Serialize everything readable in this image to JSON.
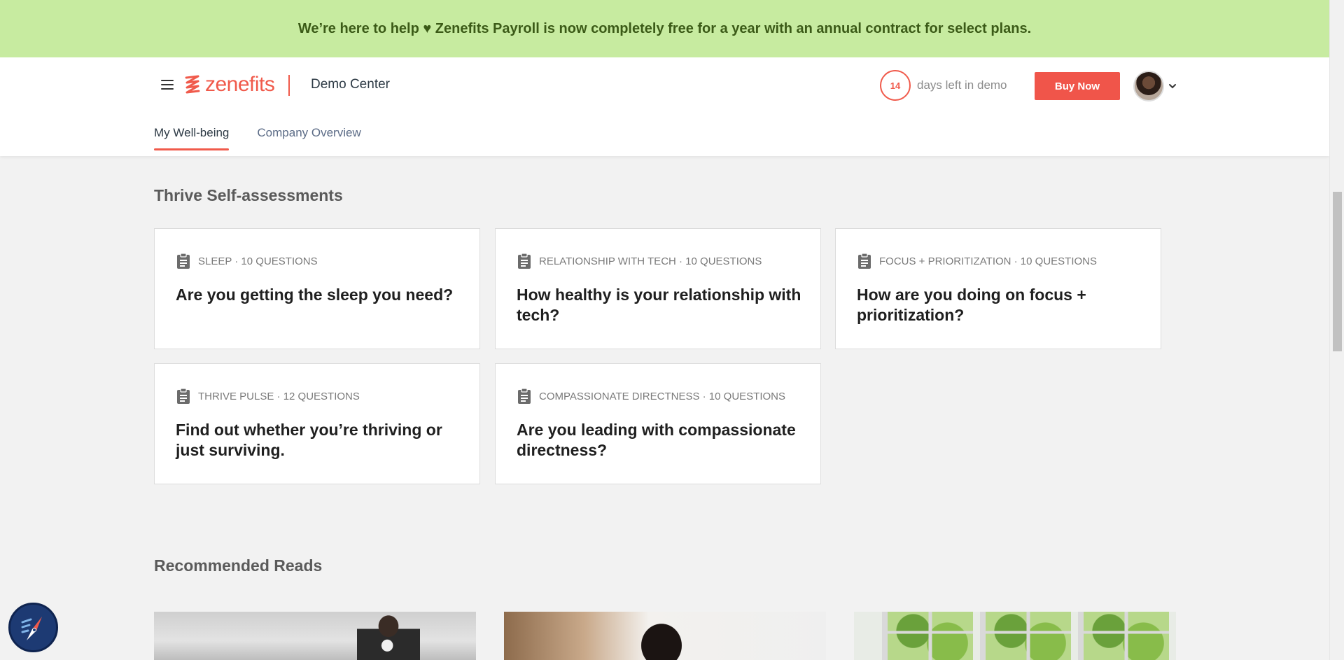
{
  "banner": {
    "text": "We’re here to help ♥ Zenefits Payroll is now completely free for a year with an annual contract for select plans."
  },
  "header": {
    "logo_text": "zenefits",
    "app_name": "Demo Center",
    "days_left": "14",
    "days_left_text": "days left in demo",
    "buy_button": "Buy Now"
  },
  "tabs": [
    {
      "label": "My Well-being",
      "active": true
    },
    {
      "label": "Company Overview",
      "active": false
    }
  ],
  "assessments": {
    "title": "Thrive Self-assessments",
    "cards": [
      {
        "meta": "SLEEP · 10 QUESTIONS",
        "title": "Are you getting the sleep you need?"
      },
      {
        "meta": "RELATIONSHIP WITH TECH · 10 QUESTIONS",
        "title": "How healthy is your relationship with tech?"
      },
      {
        "meta": "FOCUS + PRIORITIZATION · 10 QUESTIONS",
        "title": "How are you doing on focus + prioritization?"
      },
      {
        "meta": "THRIVE PULSE · 12 QUESTIONS",
        "title": "Find out whether you’re thriving or just surviving."
      },
      {
        "meta": "COMPASSIONATE DIRECTNESS · 10 QUESTIONS",
        "title": "Are you leading with compassionate directness?"
      }
    ]
  },
  "reads": {
    "title": "Recommended Reads"
  },
  "colors": {
    "accent": "#f05a4b",
    "banner_bg": "#c7eba0",
    "page_bg": "#f2f2f2",
    "compass_bg": "#1d3a73"
  },
  "icons": {
    "menu": "hamburger-menu-icon",
    "logo": "zenefits-logo-icon",
    "caret": "chevron-down-icon",
    "card": "clipboard-icon",
    "assistant": "compass-icon"
  }
}
